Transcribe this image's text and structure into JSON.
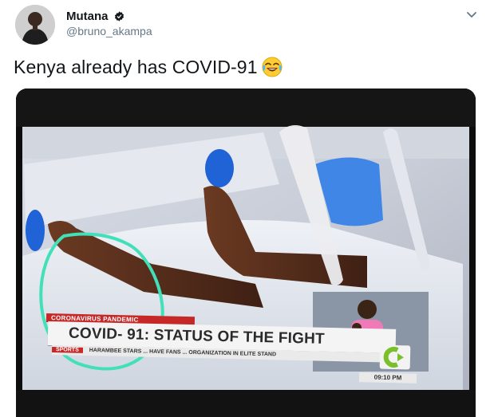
{
  "tweet": {
    "display_name": "Mutana",
    "handle": "@bruno_akampa",
    "verified_icon": "verified-badge-icon",
    "text": "Kenya already has COVID-91",
    "emoji": "face-with-tears-of-joy"
  },
  "media": {
    "lower_third_strip": "CORONAVIRUS PANDEMIC",
    "headline": "COVID- 91: STATUS OF THE FIGHT",
    "ticker_tag": "SPORTS",
    "ticker_text": "HARAMBEE STARS ... HAVE FANS ... ORGANIZATION IN ELITE STAND",
    "clock": "09:10 PM"
  },
  "colors": {
    "text_primary": "#14171a",
    "text_secondary": "#657786",
    "highlight_circle": "#41e0b8",
    "ticker_red": "#c62828"
  }
}
